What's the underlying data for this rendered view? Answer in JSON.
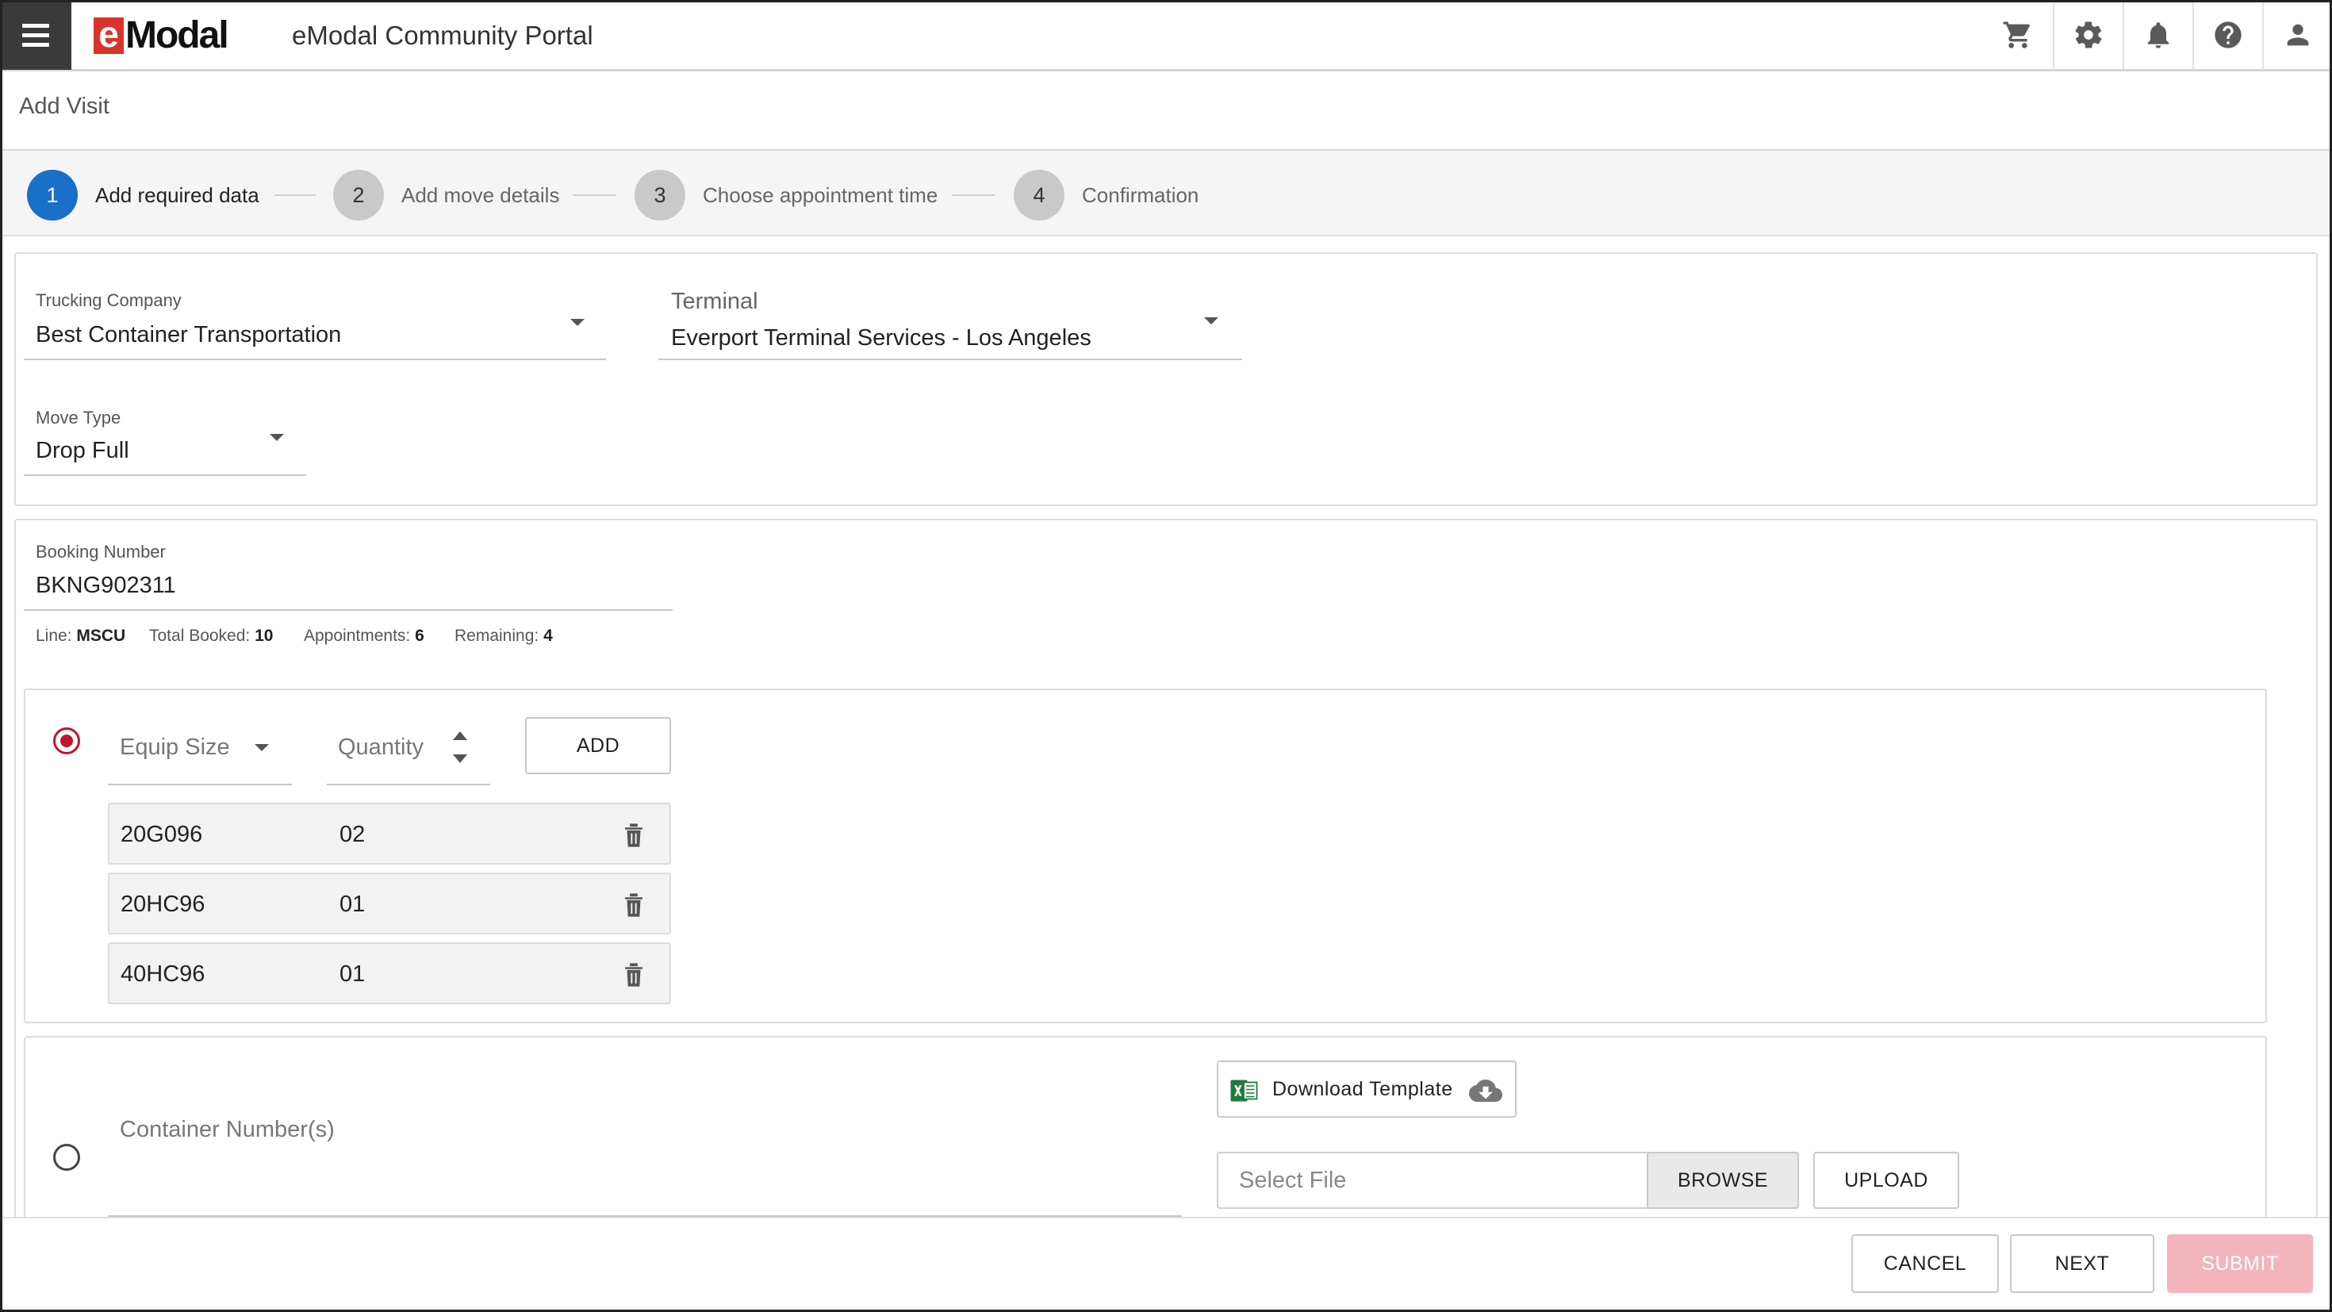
{
  "header": {
    "logo_e": "e",
    "logo_rest": "Modal",
    "portal_title": "eModal Community Portal",
    "icons": [
      "cart-icon",
      "gear-icon",
      "bell-icon",
      "help-icon",
      "user-icon"
    ]
  },
  "page": {
    "title": "Add Visit"
  },
  "stepper": {
    "steps": [
      {
        "number": "1",
        "label": "Add required data",
        "active": true
      },
      {
        "number": "2",
        "label": "Add move details",
        "active": false
      },
      {
        "number": "3",
        "label": "Choose appointment time",
        "active": false
      },
      {
        "number": "4",
        "label": "Confirmation",
        "active": false
      }
    ]
  },
  "required": {
    "trucking_company_label": "Trucking Company",
    "trucking_company_value": "Best Container Transportation",
    "terminal_label": "Terminal",
    "terminal_value": "Everport Terminal Services - Los Angeles",
    "move_type_label": "Move Type",
    "move_type_value": "Drop Full"
  },
  "booking": {
    "label": "Booking Number",
    "value": "BKNG902311",
    "line_label": "Line:",
    "line_value": "MSCU",
    "total_label": "Total Booked:",
    "total_value": "10",
    "appointments_label": "Appointments:",
    "appointments_value": "6",
    "remaining_label": "Remaining:",
    "remaining_value": "4"
  },
  "equipment": {
    "size_placeholder": "Equip Size",
    "quantity_placeholder": "Quantity",
    "add_label": "ADD",
    "rows": [
      {
        "size": "20G096",
        "quantity": "02"
      },
      {
        "size": "20HC96",
        "quantity": "01"
      },
      {
        "size": "40HC96",
        "quantity": "01"
      }
    ]
  },
  "containers": {
    "placeholder": "Container Number(s)",
    "download_label": "Download Template",
    "file_placeholder": "Select File",
    "browse_label": "BROWSE",
    "upload_label": "UPLOAD"
  },
  "footer": {
    "cancel_label": "CANCEL",
    "next_label": "NEXT",
    "submit_label": "SUBMIT"
  },
  "colors": {
    "brand_red": "#d9342b",
    "active_step": "#1a6fc9",
    "radio_red": "#c0152f",
    "submit_disabled": "#f2b5bc",
    "excel_green": "#1e7b3c"
  }
}
